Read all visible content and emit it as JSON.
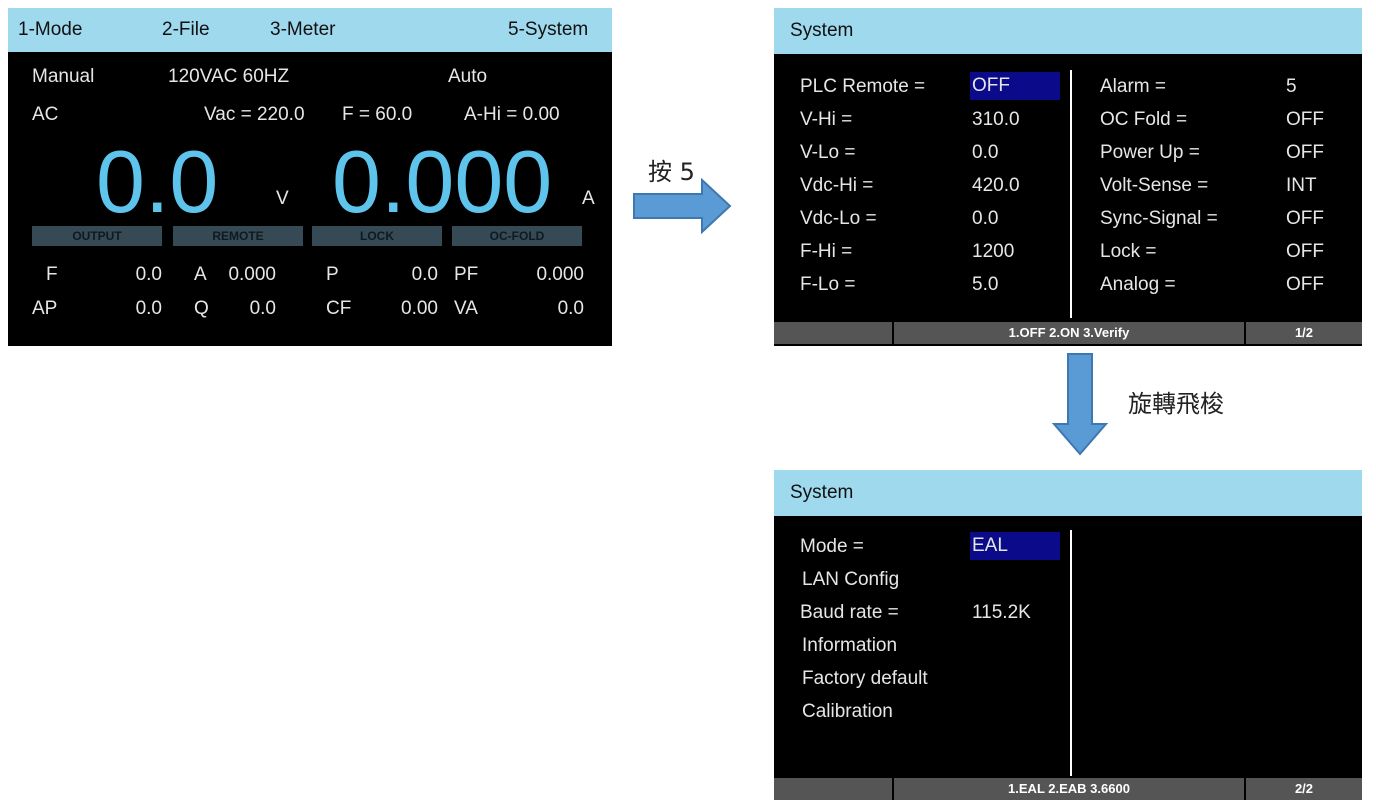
{
  "main": {
    "menu": {
      "mode": "1-Mode",
      "file": "2-File",
      "meter": "3-Meter",
      "system": "5-System"
    },
    "row1": {
      "manual": "Manual",
      "range": "120VAC 60HZ",
      "auto": "Auto"
    },
    "row2": {
      "ac": "AC",
      "vac": "Vac = 220.0",
      "freq": "F = 60.0",
      "ahi": "A-Hi = 0.00"
    },
    "voltage": {
      "value": "0.0",
      "unit": "V"
    },
    "current": {
      "value": "0.000",
      "unit": "A"
    },
    "status": [
      "OUTPUT",
      "REMOTE",
      "LOCK",
      "OC-FOLD"
    ],
    "meas1": [
      {
        "label": "F",
        "value": "0.0"
      },
      {
        "label": "A",
        "value": "0.000"
      },
      {
        "label": "P",
        "value": "0.0"
      },
      {
        "label": "PF",
        "value": "0.000"
      }
    ],
    "meas2": [
      {
        "label": "AP",
        "value": "0.0"
      },
      {
        "label": "Q",
        "value": "0.0"
      },
      {
        "label": "CF",
        "value": "0.00"
      },
      {
        "label": "VA",
        "value": "0.0"
      }
    ]
  },
  "press_label": "按 5",
  "rotate_label": "旋轉飛梭",
  "sys1": {
    "title": "System",
    "left": [
      {
        "label": "PLC Remote =",
        "value": "OFF"
      },
      {
        "label": "V-Hi =",
        "value": "310.0"
      },
      {
        "label": "V-Lo =",
        "value": "0.0"
      },
      {
        "label": "Vdc-Hi =",
        "value": "420.0"
      },
      {
        "label": "Vdc-Lo =",
        "value": "0.0"
      },
      {
        "label": "F-Hi =",
        "value": "1200"
      },
      {
        "label": "F-Lo =",
        "value": "5.0"
      }
    ],
    "right": [
      {
        "label": "Alarm =",
        "value": "5"
      },
      {
        "label": "OC Fold =",
        "value": "OFF"
      },
      {
        "label": "Power Up =",
        "value": "OFF"
      },
      {
        "label": "Volt-Sense =",
        "value": "INT"
      },
      {
        "label": "Sync-Signal =",
        "value": "OFF"
      },
      {
        "label": "Lock =",
        "value": "OFF"
      },
      {
        "label": "Analog =",
        "value": "OFF"
      }
    ],
    "footer": {
      "options": "1.OFF 2.ON 3.Verify",
      "page": "1/2"
    }
  },
  "sys2": {
    "title": "System",
    "left": [
      {
        "label": "Mode =",
        "value": "EAL"
      },
      {
        "label": "LAN Config",
        "value": ""
      },
      {
        "label": "Baud rate =",
        "value": "115.2K"
      },
      {
        "label": "Information",
        "value": ""
      },
      {
        "label": "Factory default",
        "value": ""
      },
      {
        "label": "Calibration",
        "value": ""
      }
    ],
    "footer": {
      "options": "1.EAL 2.EAB 3.6600",
      "page": "2/2"
    }
  },
  "colors": {
    "title_bar": "#9fd9ee",
    "big_readout": "#5ec4ec",
    "selection": "#0a0a8a",
    "arrow": "#5b9bd5"
  }
}
